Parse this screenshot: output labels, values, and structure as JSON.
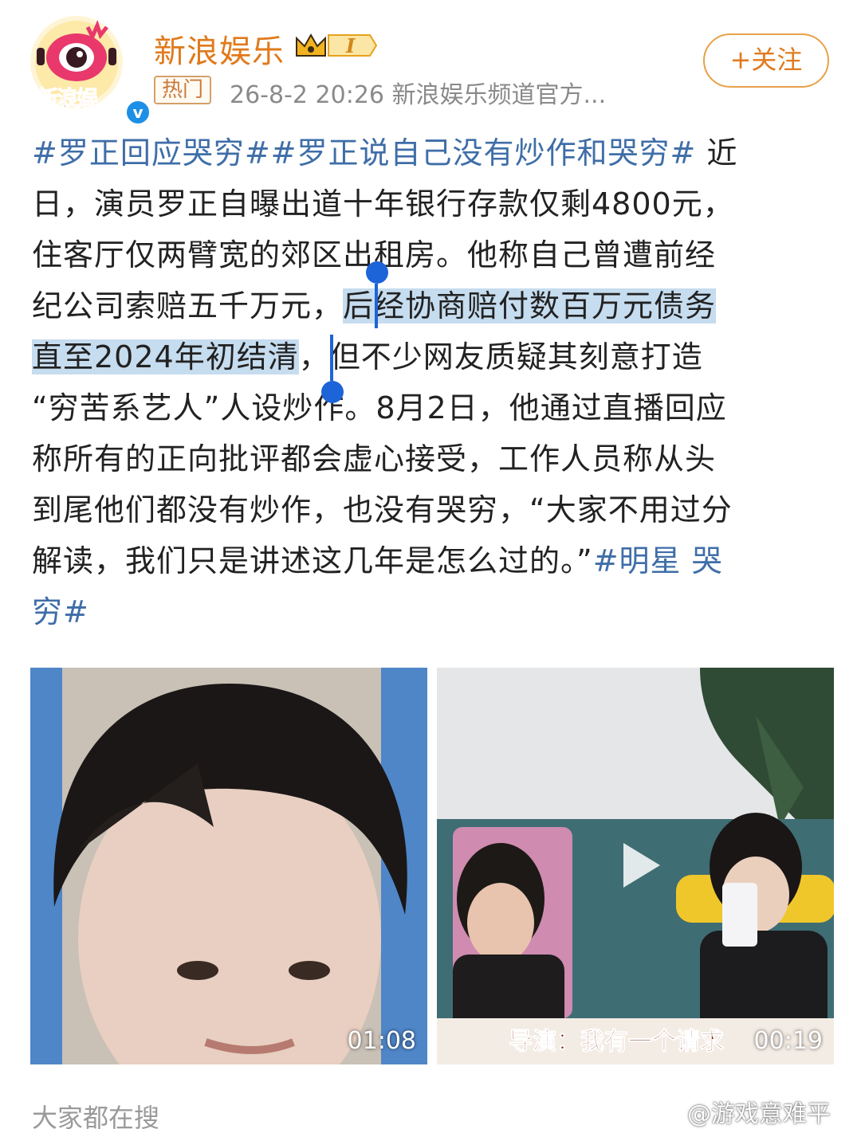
{
  "header": {
    "account_name": "新浪娱乐",
    "avatar_label": "新浪娱",
    "vip_level": "I",
    "hot_tag": "热门",
    "post_meta": "26-8-2 20:26  新浪娱乐频道官方...",
    "follow_label": "+关注",
    "verified_mark": "v"
  },
  "post": {
    "lines": [
      {
        "parts": [
          {
            "t": "#罗正回应哭穷##罗正说自己没有炒作和哭穷#",
            "k": "tag"
          },
          {
            "t": " 近",
            "k": "n"
          }
        ]
      },
      {
        "parts": [
          {
            "t": "日，演员罗正自曝出道十年银行存款仅剩4800元，",
            "k": "n"
          }
        ]
      },
      {
        "parts": [
          {
            "t": "住客厅仅两臂宽的郊区出租房。他称自己曾遭前经",
            "k": "n"
          }
        ]
      },
      {
        "parts": [
          {
            "t": "纪公司索赔五千万元，",
            "k": "n"
          },
          {
            "t": "后经协商赔付数百万元债务",
            "k": "sel"
          }
        ]
      },
      {
        "parts": [
          {
            "t": "直至2024年初结清",
            "k": "sel"
          },
          {
            "t": "，但不少网友质疑其刻意打造",
            "k": "n"
          }
        ]
      },
      {
        "parts": [
          {
            "t": "“穷苦系艺人”人设炒作。8月2日，他通过直播回应",
            "k": "n"
          }
        ]
      },
      {
        "parts": [
          {
            "t": "称所有的正向批评都会虚心接受，工作人员称从头",
            "k": "n"
          }
        ]
      },
      {
        "parts": [
          {
            "t": "到尾他们都没有炒作，也没有哭穷，“大家不用过分",
            "k": "n"
          }
        ]
      },
      {
        "parts": [
          {
            "t": "解读，我们只是讲述这几年是怎么过的。”",
            "k": "n"
          },
          {
            "t": "#明星 哭",
            "k": "tag"
          }
        ]
      },
      {
        "parts": [
          {
            "t": "穷#",
            "k": "tag"
          }
        ]
      }
    ]
  },
  "media": {
    "video1_duration": "01:08",
    "video2_duration": "00:19",
    "video2_subtitle": "导演：我有一个请求",
    "play_icon": "play-icon"
  },
  "footer": {
    "search_label": "大家都在搜",
    "watermark": "@游戏意难平"
  },
  "colors": {
    "accent_orange": "#e07a1c",
    "hashtag_blue": "#3f6ea8",
    "selection": "#c6dcef",
    "selection_handle": "#1d64d8"
  }
}
